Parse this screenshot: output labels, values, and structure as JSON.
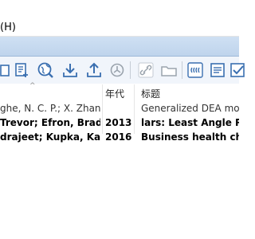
{
  "menubar": {
    "help_label": "(H)"
  },
  "toolbar": {
    "buttons": [
      "copy-icon",
      "add-reference-icon",
      "find-online-icon",
      "download-icon",
      "upload-icon",
      "sync-icon",
      "link-icon",
      "folder-icon",
      "quote-icon",
      "format-bibliography-icon",
      "checkbox-icon"
    ]
  },
  "columns": {
    "year": "年代",
    "title": "标题"
  },
  "rows": [
    {
      "authors": "ghe, N. C. P.; X. Zhang",
      "year": "",
      "title": "Generalized DEA mode",
      "unread": false
    },
    {
      "authors": " Trevor; Efron, Brad",
      "year": "2013",
      "title": "lars: Least Angle Regr",
      "unread": true
    },
    {
      "authors": "drajeet; Kupka, Kare…",
      "year": "2016",
      "title": "Business health chara…",
      "unread": true
    }
  ],
  "colors": {
    "banner": "#c6daf1",
    "icon_blue": "#3a6fb0"
  }
}
